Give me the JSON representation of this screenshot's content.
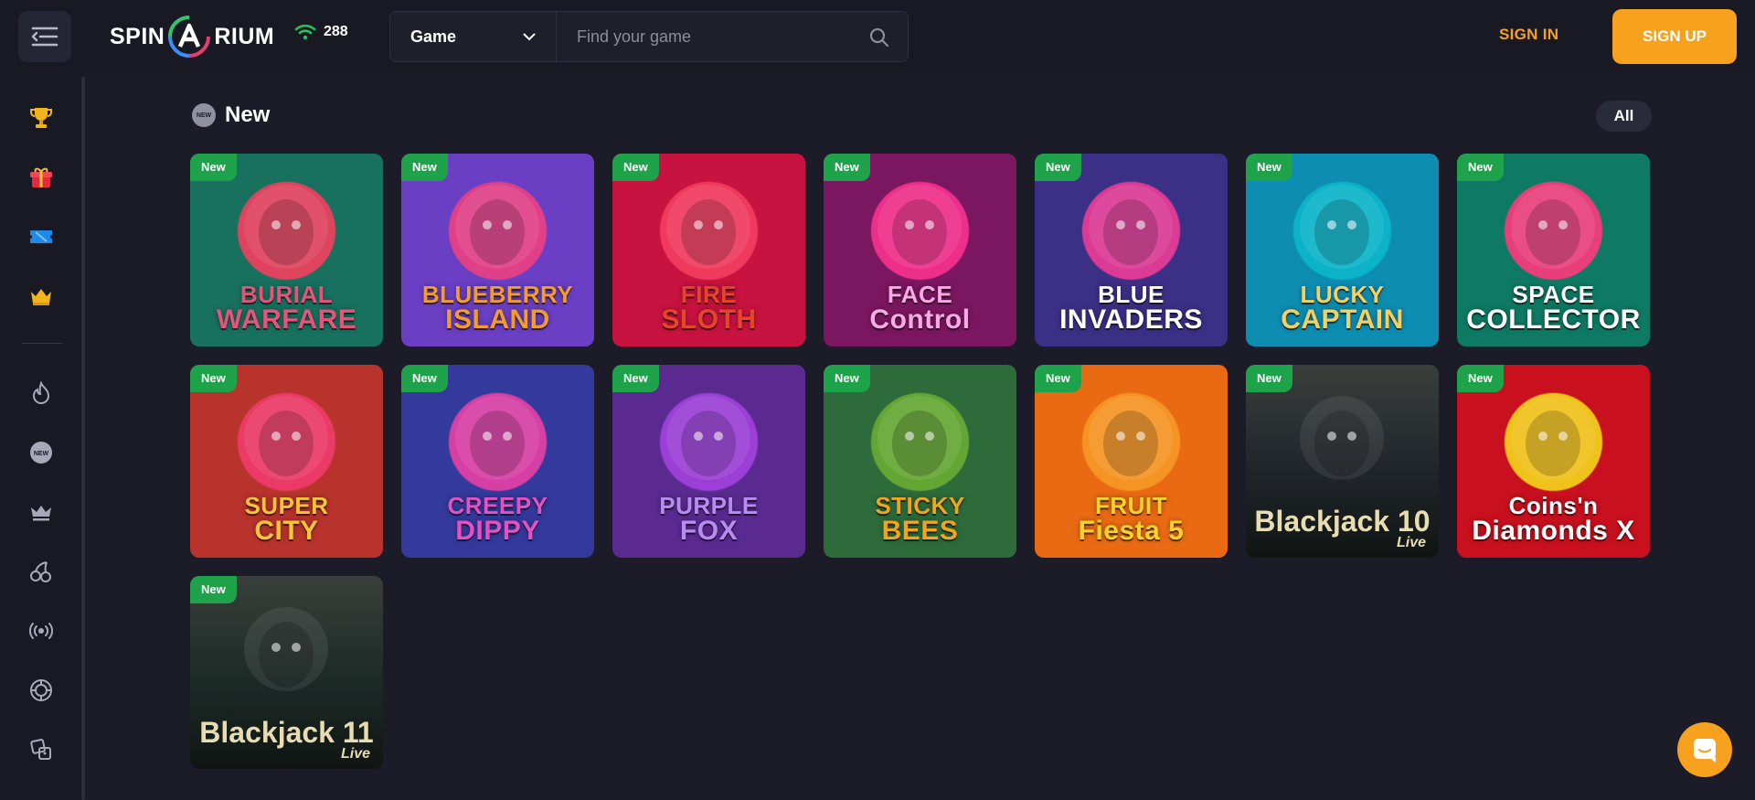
{
  "header": {
    "logo_text_left": "SPIN",
    "logo_text_right": "RIUM",
    "online_count": "288",
    "game_select": "Game",
    "search_placeholder": "Find your game",
    "sign_in": "SIGN IN",
    "sign_up": "SIGN UP"
  },
  "sidebar": {
    "icons": [
      "trophy-icon",
      "gift-icon",
      "ticket-icon",
      "crown-icon",
      "fire-icon",
      "new-icon",
      "vip-crown-icon",
      "cherry-icon",
      "live-broadcast-icon",
      "roulette-icon",
      "dice-icon"
    ]
  },
  "section": {
    "title": "New",
    "badge_icon_text": "NEW",
    "all_label": "All",
    "tag_label": "New"
  },
  "games": [
    {
      "line1": "BURIAL",
      "line2": "WARFARE",
      "bg": "#17715e",
      "accent": "#e0435e",
      "text": "#e6537b"
    },
    {
      "line1": "BLUEBERRY",
      "line2": "ISLAND",
      "bg": "#6a3fc4",
      "accent": "#e04088",
      "text": "#f39b2b"
    },
    {
      "line1": "FIRE",
      "line2": "SLOTH",
      "bg": "#c8123f",
      "accent": "#ef3a5d",
      "text": "#e6452a"
    },
    {
      "line1": "FACE",
      "line2": "Control",
      "bg": "#7b1660",
      "accent": "#ee2f8a",
      "text": "#f9a9e6"
    },
    {
      "line1": "BLUE",
      "line2": "INVADERS",
      "bg": "#3c2f86",
      "accent": "#db3b95",
      "text": "#ffffff"
    },
    {
      "line1": "LUCKY",
      "line2": "CAPTAIN",
      "bg": "#0d8db2",
      "accent": "#0bb3c9",
      "text": "#f5cf5f"
    },
    {
      "line1": "SPACE",
      "line2": "COLLECTOR",
      "bg": "#0f7a63",
      "accent": "#e83f7b",
      "text": "#ffffff"
    },
    {
      "line1": "SUPER",
      "line2": "CITY",
      "bg": "#b8332c",
      "accent": "#eb3a66",
      "text": "#f8c53a"
    },
    {
      "line1": "CREEPY",
      "line2": "DIPPY",
      "bg": "#34399c",
      "accent": "#d63fa4",
      "text": "#e252c5"
    },
    {
      "line1": "PURPLE",
      "line2": "FOX",
      "bg": "#5b2a91",
      "accent": "#9b3fd6",
      "text": "#b78cf0"
    },
    {
      "line1": "STICKY",
      "line2": "BEES",
      "bg": "#2d6b3b",
      "accent": "#64a634",
      "text": "#f0a51d"
    },
    {
      "line1": "FRUIT",
      "line2": "Fiesta 5",
      "bg": "#ea6a14",
      "accent": "#f59423",
      "text": "#f8d32e"
    },
    {
      "line1": "Blackjack 10",
      "line2": "Live",
      "bg": "#20252a",
      "accent": "#3e4a44",
      "text": "#e8dcb3"
    },
    {
      "line1": "Coins'n",
      "line2": "Diamonds X",
      "bg": "#c8101e",
      "accent": "#f0c21c",
      "text": "#ffffff"
    },
    {
      "line1": "Blackjack 11",
      "line2": "Live",
      "bg": "#1c2a26",
      "accent": "#3b4c44",
      "text": "#e8dcb3"
    }
  ],
  "colors": {
    "accent": "#f7a11e",
    "new_tag": "#1fa34a",
    "bg": "#1b1c27",
    "panel": "#181922"
  }
}
